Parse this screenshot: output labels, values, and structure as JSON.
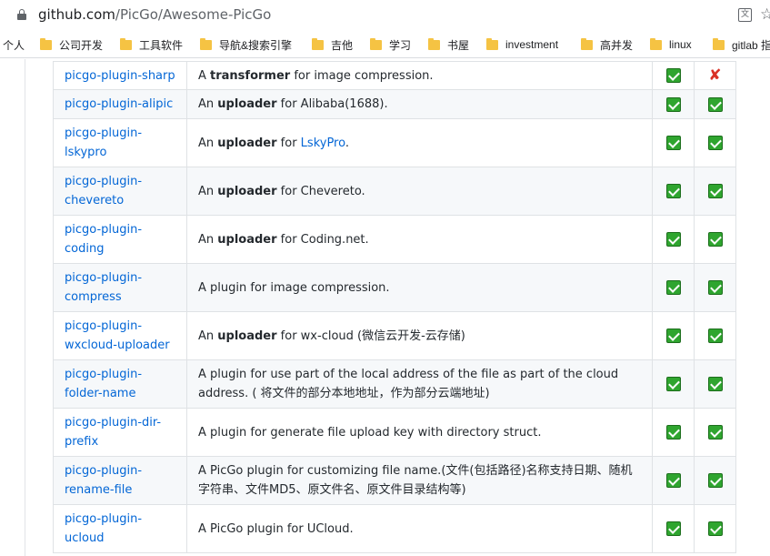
{
  "address_bar": {
    "url_host": "github.com",
    "url_path": "/PicGo/Awesome-PicGo"
  },
  "bookmarks": [
    {
      "label": "个人",
      "folder": false
    },
    {
      "label": "公司开发",
      "folder": true
    },
    {
      "label": "工具软件",
      "folder": true
    },
    {
      "label": "导航&搜索引擎",
      "folder": true
    },
    {
      "label": "吉他",
      "folder": true
    },
    {
      "label": "学习",
      "folder": true
    },
    {
      "label": "书屋",
      "folder": true
    },
    {
      "label": "investment",
      "folder": true
    },
    {
      "label": "高并发",
      "folder": true
    },
    {
      "label": "linux",
      "folder": true
    },
    {
      "label": "gitlab 指",
      "folder": true
    }
  ],
  "rows": [
    {
      "name": [
        "picgo-plugin-sharp"
      ],
      "desc": [
        {
          "t": "A "
        },
        {
          "t": "transformer",
          "b": true
        },
        {
          "t": " for image compression."
        }
      ],
      "col3": "check",
      "col4": "cross"
    },
    {
      "name": [
        "picgo-plugin-alipic"
      ],
      "desc": [
        {
          "t": "An "
        },
        {
          "t": "uploader",
          "b": true
        },
        {
          "t": " for Alibaba(1688)."
        }
      ],
      "col3": "check",
      "col4": "check"
    },
    {
      "name": [
        "picgo-plugin-",
        "lskypro"
      ],
      "desc": [
        {
          "t": "An "
        },
        {
          "t": "uploader",
          "b": true
        },
        {
          "t": " for "
        },
        {
          "t": "LskyPro",
          "link": true
        },
        {
          "t": "."
        }
      ],
      "col3": "check",
      "col4": "check"
    },
    {
      "name": [
        "picgo-plugin-",
        "chevereto"
      ],
      "desc": [
        {
          "t": "An "
        },
        {
          "t": "uploader",
          "b": true
        },
        {
          "t": " for Chevereto."
        }
      ],
      "col3": "check",
      "col4": "check"
    },
    {
      "name": [
        "picgo-plugin-",
        "coding"
      ],
      "desc": [
        {
          "t": "An "
        },
        {
          "t": "uploader",
          "b": true
        },
        {
          "t": " for Coding.net."
        }
      ],
      "col3": "check",
      "col4": "check"
    },
    {
      "name": [
        "picgo-plugin-",
        "compress"
      ],
      "desc": [
        {
          "t": "A plugin for image compression."
        }
      ],
      "col3": "check",
      "col4": "check"
    },
    {
      "name": [
        "picgo-plugin-",
        "wxcloud-uploader"
      ],
      "desc": [
        {
          "t": "An "
        },
        {
          "t": "uploader",
          "b": true
        },
        {
          "t": " for wx-cloud (微信云开发-云存储)"
        }
      ],
      "col3": "check",
      "col4": "check"
    },
    {
      "name": [
        "picgo-plugin-",
        "folder-name"
      ],
      "desc": [
        {
          "t": "A plugin for use part of the local address of the file as part of the cloud address. ( 将文件的部分本地地址，作为部分云端地址)"
        }
      ],
      "col3": "check",
      "col4": "check"
    },
    {
      "name": [
        "picgo-plugin-dir-",
        "prefix"
      ],
      "desc": [
        {
          "t": "A plugin for generate file upload key with directory struct."
        }
      ],
      "col3": "check",
      "col4": "check"
    },
    {
      "name": [
        "picgo-plugin-",
        "rename-file"
      ],
      "desc": [
        {
          "t": "A PicGo plugin for customizing file name.(文件(包括路径)名称支持日期、随机字符串、文件MD5、原文件名、原文件目录结构等)"
        }
      ],
      "col3": "check",
      "col4": "check"
    },
    {
      "name": [
        "picgo-plugin-",
        "ucloud"
      ],
      "desc": [
        {
          "t": "A PicGo plugin for UCloud."
        }
      ],
      "col3": "check",
      "col4": "check"
    }
  ]
}
